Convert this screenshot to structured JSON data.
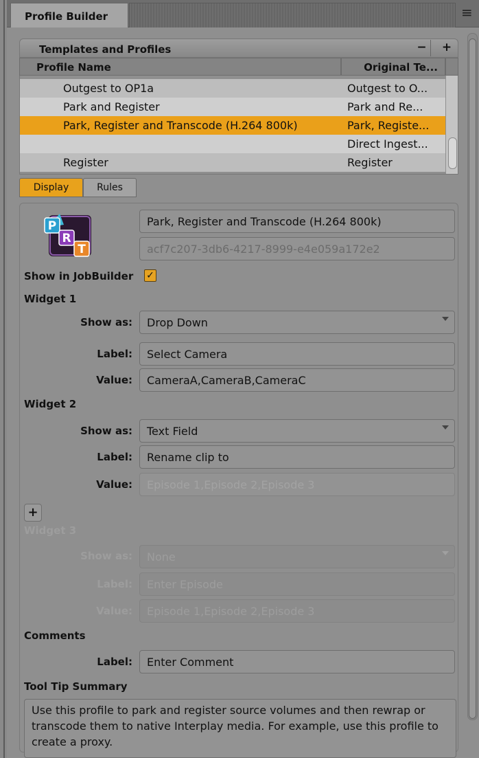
{
  "window": {
    "tab_title": "Profile Builder",
    "menu_icon": "hamburger-menu-icon"
  },
  "templates": {
    "title": "Templates and Profiles",
    "minus_label": "−",
    "plus_label": "+",
    "columns": {
      "name": "Profile Name",
      "original": "Original Te..."
    },
    "rows": [
      {
        "name": "Outgest to OP1a",
        "original": "Outgest to O..."
      },
      {
        "name": "Park and Register",
        "original": "Park and Re..."
      },
      {
        "name": "Park, Register and Transcode (H.264 800k)",
        "original": "Park, Registe...",
        "selected": true
      },
      {
        "name": "",
        "original": "Direct Ingest..."
      },
      {
        "name": "Register",
        "original": "Register"
      }
    ]
  },
  "subtabs": {
    "display": "Display",
    "rules": "Rules",
    "active": "Display"
  },
  "profile": {
    "icon": "prt-profile-icon",
    "name": "Park, Register and Transcode (H.264 800k)",
    "id": "acf7c207-3db6-4217-8999-e4e059a172e2",
    "show_in_jobbuilder_label": "Show in JobBuilder",
    "show_in_jobbuilder": true
  },
  "widget1": {
    "heading": "Widget 1",
    "show_as_label": "Show as:",
    "show_as": "Drop Down",
    "label_label": "Label:",
    "label": "Select Camera",
    "value_label": "Value:",
    "value": "CameraA,CameraB,CameraC"
  },
  "widget2": {
    "heading": "Widget 2",
    "show_as_label": "Show as:",
    "show_as": "Text Field",
    "label_label": "Label:",
    "label": "Rename clip to",
    "value_label": "Value:",
    "value_placeholder": "Episode 1,Episode 2,Episode 3"
  },
  "add_widget_label": "+",
  "widget3": {
    "heading": "Widget 3",
    "show_as_label": "Show as:",
    "show_as": "None",
    "label_label": "Label:",
    "label_placeholder": "Enter Episode",
    "value_label": "Value:",
    "value_placeholder": "Episode 1,Episode 2,Episode 3"
  },
  "comments": {
    "heading": "Comments",
    "label_label": "Label:",
    "label": "Enter Comment"
  },
  "tooltip": {
    "heading": "Tool Tip Summary",
    "text": "Use this profile to park and register source volumes and then rewrap or transcode them to native Interplay media. For example, use this profile to create a proxy."
  },
  "colors": {
    "accent": "#eaa01a",
    "panel": "#8f8f8f"
  }
}
